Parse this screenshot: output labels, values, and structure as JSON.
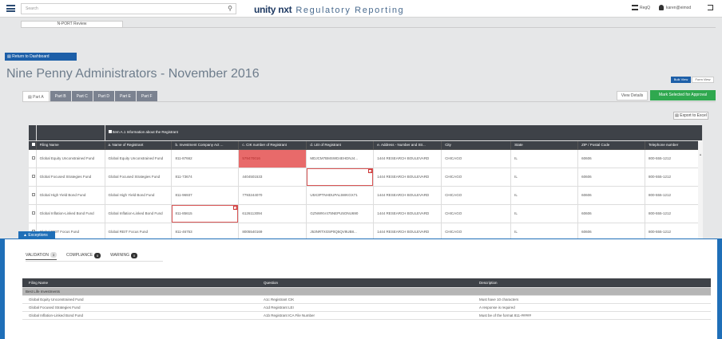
{
  "header": {
    "search_placeholder": "Search",
    "brand": "unity nxt",
    "brand_sub": "Regulatory Reporting",
    "regs_label": "RegQ",
    "user_label": "karen@eimod"
  },
  "nav": {
    "subtab": "N-PORT Review",
    "return_button": "Return to Dashboard"
  },
  "page": {
    "title": "Nine Penny Administrators - November 2016",
    "bulk_view": "Bulk View",
    "form_view": "Form View",
    "tabs": [
      "Part A",
      "Part B",
      "Part C",
      "Part D",
      "Part E",
      "Part F"
    ],
    "view_details": "View Details",
    "mark_approval": "Mark Selected for Approval",
    "export_excel": "Export to Excel"
  },
  "grid": {
    "group_header": "Item A.1 Information about the Registrant",
    "columns": [
      "Filing Name",
      "a. Name of Registrant",
      "b. Investment Company Act ...",
      "c. CIK number of Registrant",
      "d. LEI of Registrant",
      "e. Address - Number and Str...",
      "City",
      "State",
      "ZIP / Postal Code",
      "Telephone number"
    ],
    "rows": [
      [
        "Global Equity Unconstrained Fund",
        "Global Equity Unconstrained Fund",
        "811-87662",
        "579470016",
        "MDJCM7BMSWD4EHDNJ4...",
        "1444 RESEARCH BOULEVARD",
        "CHICAGO",
        "IL",
        "60606",
        "800-555-1212"
      ],
      [
        "Global Focused Strategies Fund",
        "Global Focused Strategies Fund",
        "811-73674",
        "4404501533",
        "",
        "1444 RESEARCH BOULEVARD",
        "CHICAGO",
        "IL",
        "60606",
        "800-555-1212"
      ],
      [
        "Global High Yield Bond Fund",
        "Global High Yield Bond Fund",
        "811-96937",
        "7793244070",
        "U5X3PTNHDUPAL5WKGX71",
        "1444 RESEARCH BOULEVARD",
        "CHICAGO",
        "IL",
        "60606",
        "800-555-1212"
      ],
      [
        "Global Inflation-Linked Bond Fund",
        "Global Inflation-Linked Bond Fund",
        "811-85615",
        "6126113094",
        "GZNWNV475NEPU5ONU690",
        "1444 RESEARCH BOULEVARD",
        "CHICAGO",
        "IL",
        "60606",
        "800-555-1212"
      ],
      [
        "Global REIT Focus Fund",
        "Global REIT Focus Fund",
        "811-46753",
        "8005540169",
        "J53NRTXG5P0Q5QV8UB8...",
        "1444 RESEARCH BOULEVARD",
        "CHICAGO",
        "IL",
        "60606",
        "800-555-1212"
      ]
    ]
  },
  "exceptions": {
    "tab_label": "Exceptions",
    "validation_label": "VALIDATION",
    "validation_count": "3",
    "compliance_label": "COMPLIANCE",
    "compliance_count": "0",
    "warning_label": "WARNING",
    "warning_count": "0",
    "columns": [
      "Filing Name",
      "Question",
      "Description"
    ],
    "group": "Best Life Investments",
    "rows": [
      [
        "Global Equity Unconstrained Fund",
        "A1c Registrant CIK",
        "Must have 10 characters"
      ],
      [
        "Global Focused Strategies Fund",
        "A1d Registrant LEI",
        "A response is required"
      ],
      [
        "Global Inflation-Linked Bond Fund",
        "A1b Registrant ICA File Number",
        "Must be of the format 811-#####"
      ]
    ]
  },
  "colors": {
    "primary": "#1d5fa8",
    "success": "#2fa84f",
    "error_fill": "#e86a6a",
    "header_dark": "#3e4248"
  }
}
